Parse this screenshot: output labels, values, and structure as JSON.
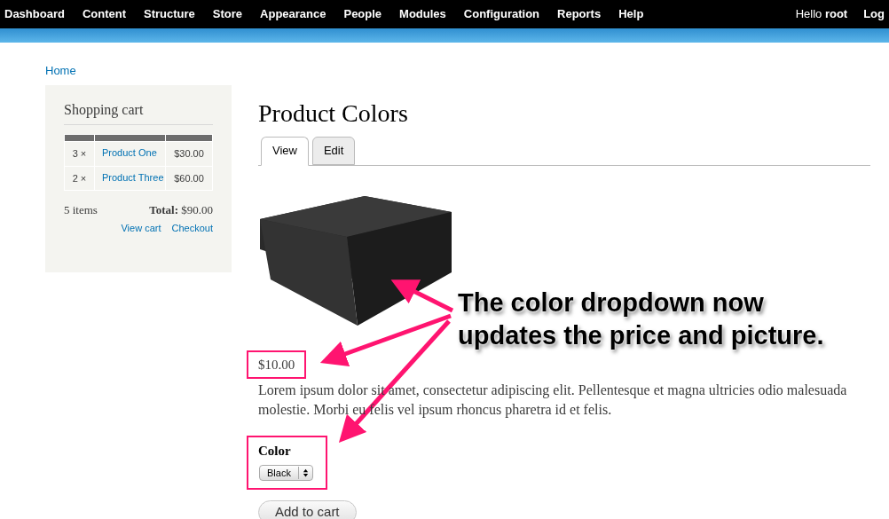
{
  "toolbar": {
    "menu": [
      "Dashboard",
      "Content",
      "Structure",
      "Store",
      "Appearance",
      "People",
      "Modules",
      "Configuration",
      "Reports",
      "Help"
    ],
    "greeting": "Hello **root**",
    "logout": "Log"
  },
  "breadcrumb": [
    "Home"
  ],
  "cart": {
    "title": "Shopping cart",
    "rows": [
      {
        "qty": "3 ×",
        "product": "Product One",
        "price": "$30.00"
      },
      {
        "qty": "2 ×",
        "product": "Product Three",
        "price": "$60.00"
      }
    ],
    "count": "5 items",
    "total": "**Total:** $90.00",
    "links": [
      "View cart",
      "Checkout"
    ]
  },
  "page": {
    "title": "Product Colors",
    "tabs": [
      {
        "label": "View",
        "selected": true
      },
      {
        "label": "Edit",
        "selected": false
      }
    ],
    "price": "$10.00",
    "body": "Lorem ipsum dolor sit amet, consectetur adipiscing elit. Pellentesque et magna ultricies odio malesuada molestie. Morbi eu felis vel ipsum rhoncus pharetra id et felis.",
    "color_field": {
      "label": "Color",
      "value": "Black"
    },
    "button": "Add to cart"
  },
  "annotation": {
    "lines": [
      "The color dropdown now",
      "updates the price and picture."
    ]
  }
}
